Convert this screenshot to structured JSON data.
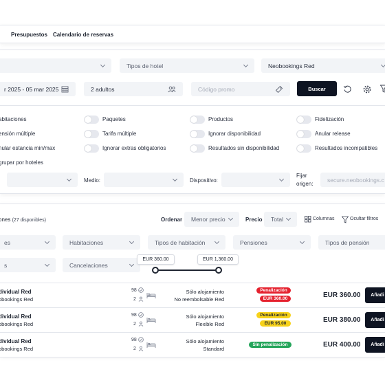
{
  "tabs": [
    "Presupuestos",
    "Calendario de reservas"
  ],
  "filters": {
    "hotel_type_placeholder": "Tipos de hotel",
    "chain": "Neobookings Red",
    "dates": "r 2025 - 05 mar 2025",
    "guests": "2 adultos",
    "promo_placeholder": "Código promo",
    "search_label": "Buscar"
  },
  "options": {
    "col1": [
      "abitaciones",
      "ensión múltiple",
      "nular estancia min/max",
      "grupar por hoteles"
    ],
    "col2": [
      "Paquetes",
      "Tarifa múltiple",
      "Ignorar extras obligatorios"
    ],
    "col3": [
      "Productos",
      "Ignorar disponibilidad",
      "Resultados sin disponibilidad"
    ],
    "col4": [
      "Fidelización",
      "Anular release",
      "Resultados incompatibles"
    ]
  },
  "channel": {
    "medio_label": "Medio:",
    "device_label": "Dispositivo:",
    "origin_label_1": "Fijar",
    "origin_label_2": "origen:",
    "origin_value": "secure.neobookings.c"
  },
  "results": {
    "title_prefix": "ones",
    "count": "(27 disponibles)",
    "sort_label": "Ordenar",
    "sort_value": "Menor precio",
    "price_label": "Precio",
    "price_value": "Total",
    "columns_label": "Columnas",
    "hide_filters_label": "Ocultar filtros",
    "filter_row1": [
      "es",
      "Habitaciones",
      "Tipos de habitación",
      "Pensiones",
      "Tipos de pensión"
    ],
    "filter_row2": [
      "s",
      "Cancelaciones"
    ],
    "range_min": "EUR 360.00",
    "range_max": "EUR 1,360.00",
    "range_fraction": {
      "min": 0.0,
      "max": 1.0
    }
  },
  "rows": [
    {
      "room": "dividual Red",
      "hotel": "obookings Red",
      "avail": "98",
      "guests": "2",
      "board": "Sólo alojamiento",
      "rate": "No reembolsable Red",
      "badge": "Penalización",
      "badge_amount": "EUR 360.00",
      "badge_color": "#e5222f",
      "price": "EUR 360.00",
      "action": "Añadi"
    },
    {
      "room": "dividual Red",
      "hotel": "obookings Red",
      "avail": "98",
      "guests": "2",
      "board": "Sólo alojamiento",
      "rate": "Flexible Red",
      "badge": "Penalización",
      "badge_amount": "EUR 95.00",
      "badge_color": "#f7d21a",
      "price": "EUR 380.00",
      "action": "Añadi"
    },
    {
      "room": "dividual Red",
      "hotel": "obookings Red",
      "avail": "98",
      "guests": "2",
      "board": "Sólo alojamiento",
      "rate": "Standard",
      "badge": "Sin penalización",
      "badge_amount": "",
      "badge_color": "#24a55a",
      "price": "EUR 400.00",
      "action": "Añadi"
    }
  ]
}
